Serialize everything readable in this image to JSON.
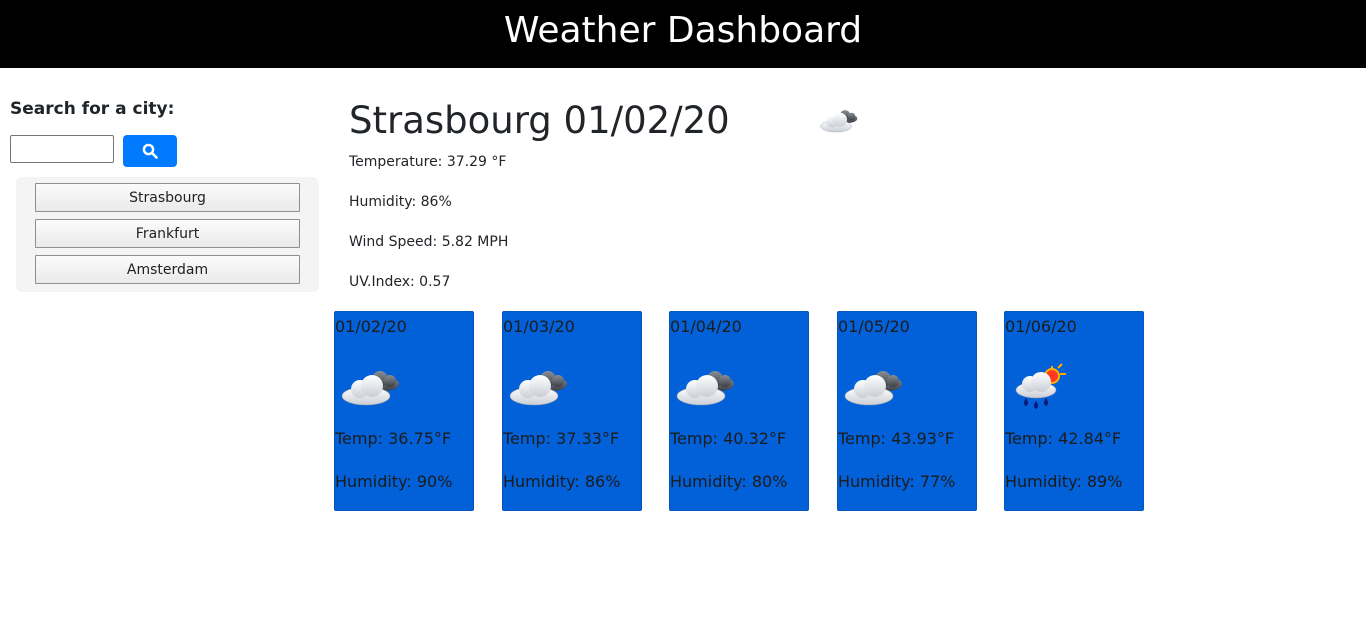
{
  "header": {
    "title": "Weather Dashboard"
  },
  "search": {
    "label": "Search for a city:",
    "value": "",
    "button_icon": "search-icon"
  },
  "history": [
    "Strasbourg",
    "Frankfurt",
    "Amsterdam"
  ],
  "current": {
    "title": "Strasbourg 01/02/20",
    "icon": "partly-cloudy-icon",
    "temperature": "Temperature: 37.29 °F",
    "humidity": "Humidity: 86%",
    "wind": "Wind Speed: 5.82 MPH",
    "uv": "UV.Index: 0.57"
  },
  "forecast": [
    {
      "date": "01/02/20",
      "icon": "cloudy-icon",
      "temp": "Temp: 36.75°F",
      "humidity": "Humidity: 90%"
    },
    {
      "date": "01/03/20",
      "icon": "cloudy-icon",
      "temp": "Temp: 37.33°F",
      "humidity": "Humidity: 86%"
    },
    {
      "date": "01/04/20",
      "icon": "cloudy-icon",
      "temp": "Temp: 40.32°F",
      "humidity": "Humidity: 80%"
    },
    {
      "date": "01/05/20",
      "icon": "cloudy-icon",
      "temp": "Temp: 43.93°F",
      "humidity": "Humidity: 77%"
    },
    {
      "date": "01/06/20",
      "icon": "rain-sun-icon",
      "temp": "Temp: 42.84°F",
      "humidity": "Humidity: 89%"
    }
  ],
  "colors": {
    "header_bg": "#000000",
    "accent": "#007bff",
    "card_bg": "#0261d8"
  }
}
